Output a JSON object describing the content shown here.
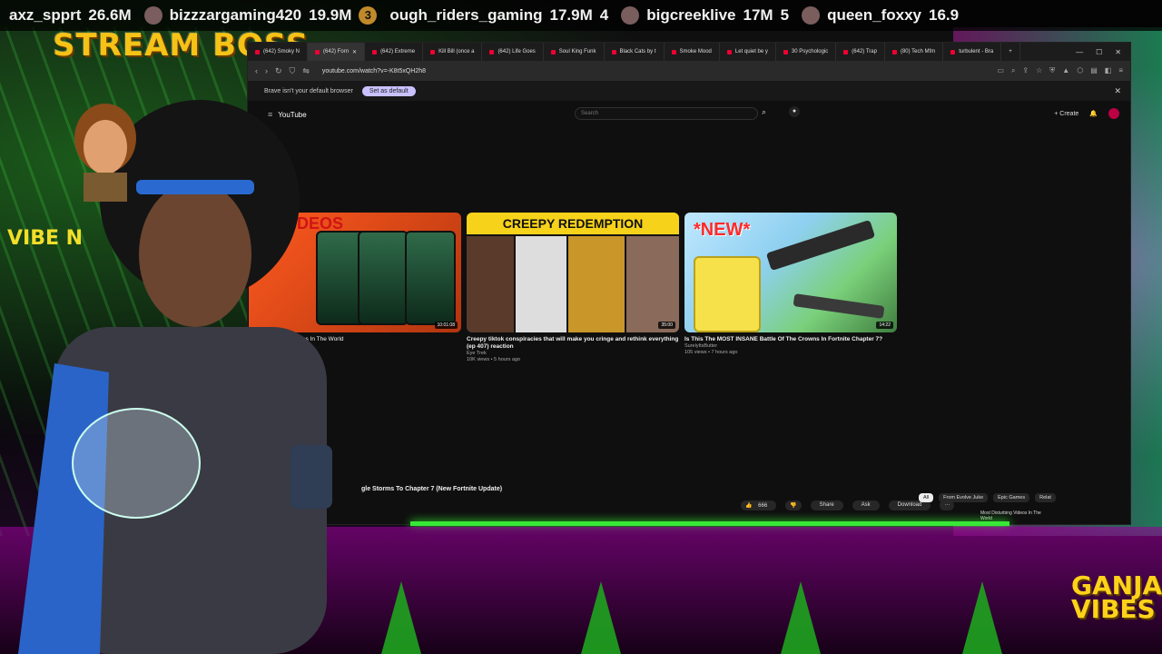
{
  "ticker": [
    {
      "name": "axz_spprt",
      "count": "26.6M",
      "rank": ""
    },
    {
      "name": "bizzzargaming420",
      "count": "19.9M",
      "rank": "3"
    },
    {
      "name": "ough_riders_gaming",
      "count": "17.9M",
      "rank": "4"
    },
    {
      "name": "bigcreeklive",
      "count": "17M",
      "rank": "5"
    },
    {
      "name": "queen_foxxy",
      "count": "16.9",
      "rank": ""
    }
  ],
  "overlay": {
    "stream_boss": "STREAM BOSS",
    "vibe_text": "VIBE N",
    "ganja_line1": "GANJA",
    "ganja_line2": "VIBES"
  },
  "browser": {
    "tabs": [
      {
        "label": "(642) Smoky N"
      },
      {
        "label": "(642) Forn"
      },
      {
        "label": "(642) Extreme"
      },
      {
        "label": "Kill Bill (once a"
      },
      {
        "label": "(642) Life Goes"
      },
      {
        "label": "Soul King Funk"
      },
      {
        "label": "Black Cats by t"
      },
      {
        "label": "Smoke Mood"
      },
      {
        "label": "Let quiet be y"
      },
      {
        "label": "30 Psychologic"
      },
      {
        "label": "(642) Trap"
      },
      {
        "label": "(80) Tech Mfm"
      },
      {
        "label": "turbulent - Bra"
      }
    ],
    "url": "youtube.com/watch?v=-K8t5xQH2h8",
    "infobar_text": "Brave isn't your default browser",
    "set_default": "Set as default"
  },
  "youtube": {
    "logo": "YouTube",
    "search_placeholder": "Search",
    "create": "Create",
    "videos": [
      {
        "thumb_heading": "ED VIDEOS",
        "title": "Videos In The World",
        "channel": "",
        "meta": "",
        "duration": "10:01:08"
      },
      {
        "thumb_heading": "CREEPY REDEMPTION",
        "title": "Creepy tiktok conspiracies that will make you cringe and rethink everything (ep 407) reaction",
        "channel": "Eye Trek",
        "meta": "10K views • 5 hours ago",
        "duration": "35:00"
      },
      {
        "thumb_heading": "*NEW*",
        "title": "Is This The MOST INSANE Battle Of The Crowns In Fortnite Chapter 7?",
        "channel": "SurelyItsButter",
        "meta": "105 views • 7 hours ago",
        "duration": "14:22"
      }
    ],
    "player_title": "gle Storms To Chapter 7 (New Fortnite Update)",
    "actions": {
      "likes": "666",
      "share": "Share",
      "ask": "Ask",
      "download": "Download"
    },
    "chips": [
      "All",
      "From Evolve Juke",
      "Epic Games",
      "Relat"
    ],
    "side_video": "Most Disturbing Videos In The World"
  }
}
